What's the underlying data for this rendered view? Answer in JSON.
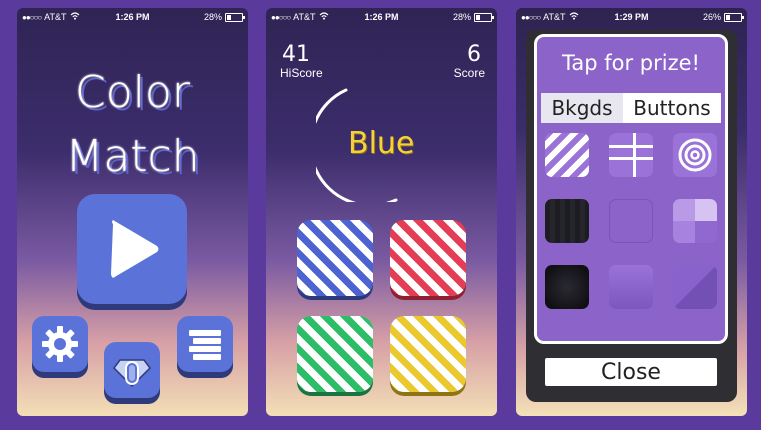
{
  "screens": [
    {
      "status": {
        "carrier": "AT&T",
        "time": "1:26 PM",
        "battery": "28%",
        "battery_level": 0.28
      },
      "title_line1": "Color",
      "title_line2": "Match",
      "buttons": {
        "play_icon": "play-icon",
        "settings_icon": "gear-icon",
        "shop_icon": "gem-icon",
        "menu_icon": "menu-icon"
      }
    },
    {
      "status": {
        "carrier": "AT&T",
        "time": "1:26 PM",
        "battery": "28%",
        "battery_level": 0.28
      },
      "hiscore_value": "41",
      "hiscore_label": "HiScore",
      "score_value": "6",
      "score_label": "Score",
      "color_word": "Blue",
      "tiles": [
        "blue",
        "red",
        "green",
        "yellow"
      ],
      "colors": {
        "blue": "#4d63d0",
        "red": "#e43d56",
        "green": "#2dbd68",
        "yellow": "#eac92f",
        "word": "#f4d23a"
      }
    },
    {
      "status": {
        "carrier": "AT&T",
        "time": "1:29 PM",
        "battery": "26%",
        "battery_level": 0.26
      },
      "prize_title": "Tap for prize!",
      "tabs": [
        "Bkgds",
        "Buttons"
      ],
      "close_label": "Close"
    }
  ],
  "colors": {
    "background": "#5b3a9e",
    "accent_blue": "#5b72d8",
    "panel_purple": "#8c64c9"
  }
}
